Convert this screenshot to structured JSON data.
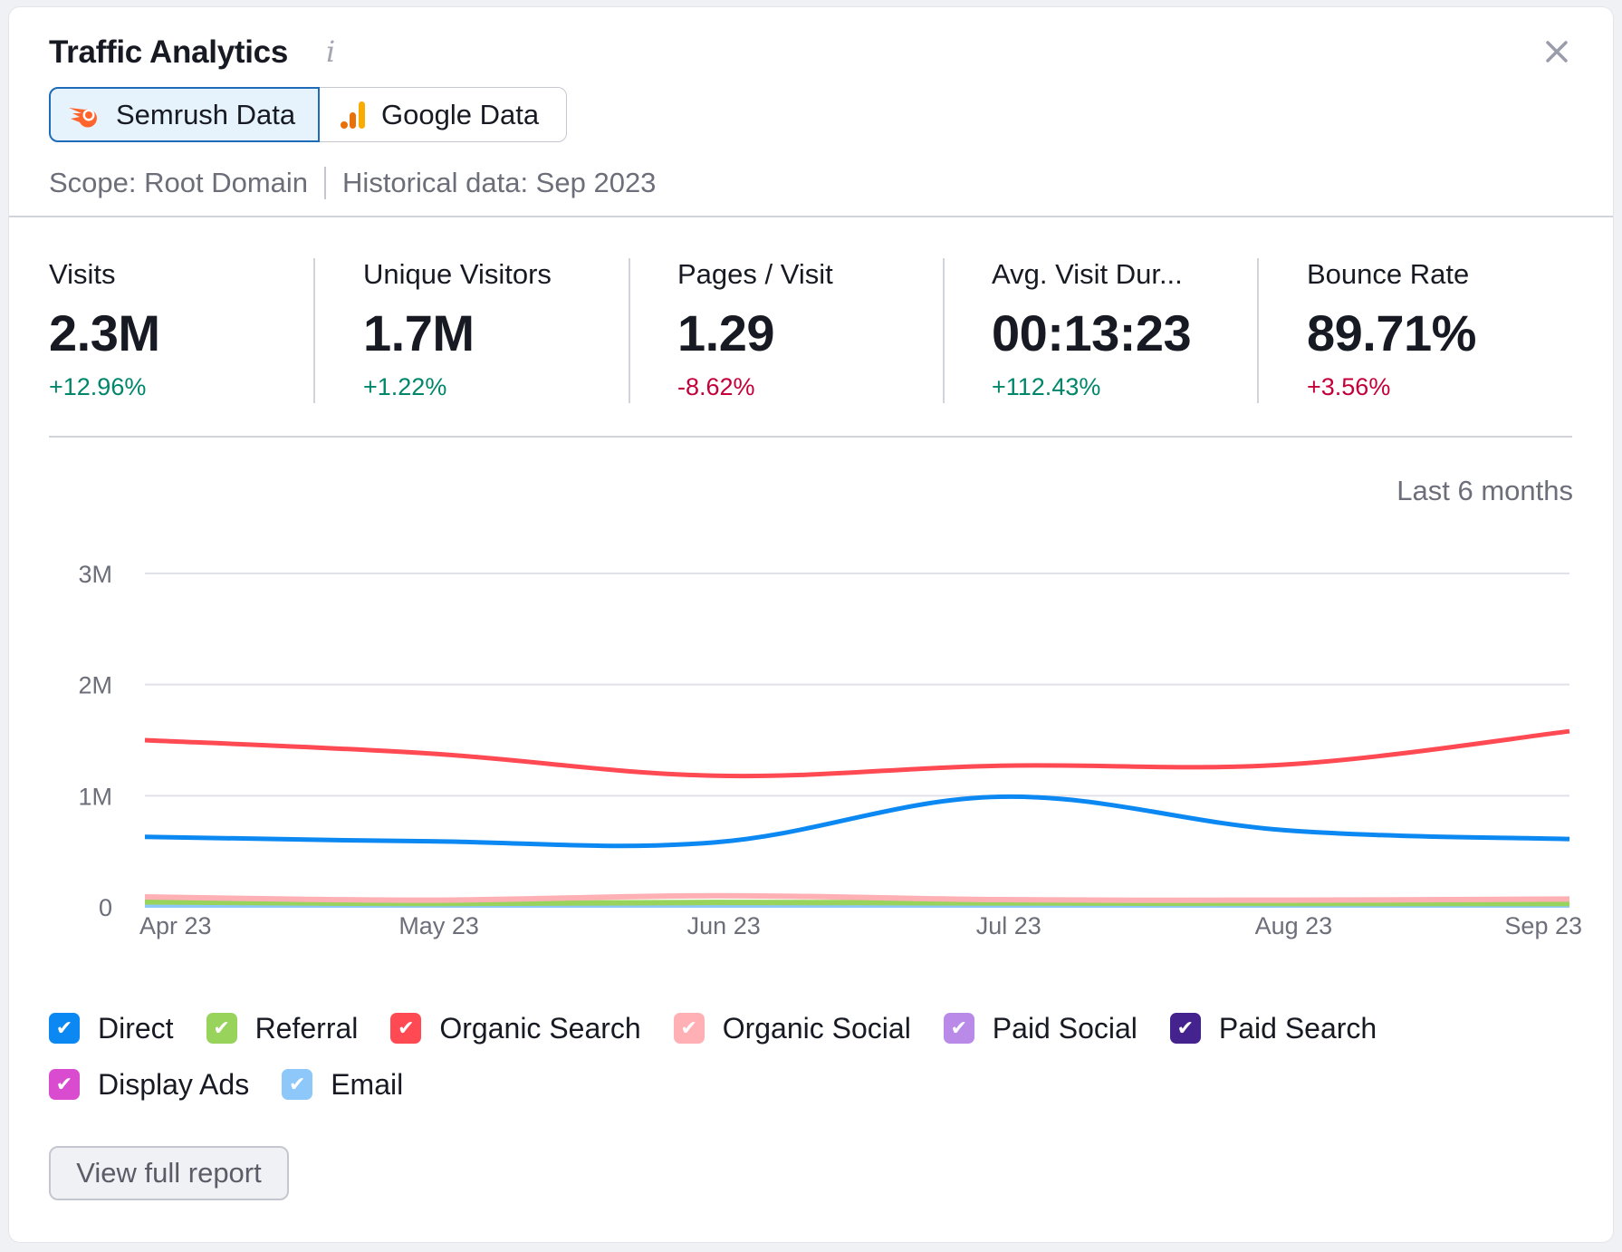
{
  "header": {
    "title": "Traffic Analytics",
    "info_icon": "info-icon",
    "close_icon": "close-icon"
  },
  "source_toggle": {
    "options": [
      {
        "label": "Semrush Data",
        "icon": "semrush-logo-icon",
        "active": true
      },
      {
        "label": "Google Data",
        "icon": "google-analytics-icon",
        "active": false
      }
    ]
  },
  "scope": {
    "scope_text": "Scope: Root Domain",
    "historical_text": "Historical data: Sep 2023"
  },
  "metrics": [
    {
      "label": "Visits",
      "value": "2.3M",
      "delta": "+12.96%",
      "trend": "up"
    },
    {
      "label": "Unique Visitors",
      "value": "1.7M",
      "delta": "+1.22%",
      "trend": "up"
    },
    {
      "label": "Pages / Visit",
      "value": "1.29",
      "delta": "-8.62%",
      "trend": "down"
    },
    {
      "label": "Avg. Visit Dur...",
      "value": "00:13:23",
      "delta": "+112.43%",
      "trend": "up"
    },
    {
      "label": "Bounce Rate",
      "value": "89.71%",
      "delta": "+3.56%",
      "trend": "down"
    }
  ],
  "colors": {
    "positive": "#00866b",
    "negative": "#c4003a",
    "accent": "#1e6bb8"
  },
  "period_label": "Last 6 months",
  "chart_data": {
    "type": "line",
    "title": "",
    "xlabel": "",
    "ylabel": "",
    "categories": [
      "Apr 23",
      "May 23",
      "Jun 23",
      "Jul 23",
      "Aug 23",
      "Sep 23"
    ],
    "ylim": [
      0,
      3000000
    ],
    "yticks": [
      0,
      1000000,
      2000000,
      3000000
    ],
    "ytick_labels": [
      "0",
      "1M",
      "2M",
      "3M"
    ],
    "grid": true,
    "legend_position": "bottom",
    "series": [
      {
        "name": "Direct",
        "color": "#0c88f2",
        "values": [
          630000,
          590000,
          580000,
          990000,
          690000,
          610000
        ]
      },
      {
        "name": "Referral",
        "color": "#98d35c",
        "values": [
          45000,
          30000,
          40000,
          35000,
          30000,
          30000
        ]
      },
      {
        "name": "Organic Search",
        "color": "#ff4953",
        "values": [
          1500000,
          1380000,
          1180000,
          1270000,
          1280000,
          1580000
        ]
      },
      {
        "name": "Organic Social",
        "color": "#ffb0b5",
        "values": [
          90000,
          60000,
          100000,
          65000,
          60000,
          70000
        ]
      },
      {
        "name": "Paid Social",
        "color": "#b98ae8",
        "values": [
          2000,
          2000,
          2000,
          2000,
          2000,
          2000
        ]
      },
      {
        "name": "Paid Search",
        "color": "#44238e",
        "values": [
          1000,
          1000,
          1000,
          1000,
          1000,
          1000
        ]
      },
      {
        "name": "Display Ads",
        "color": "#d94ccf",
        "values": [
          1000,
          1000,
          1000,
          1000,
          1000,
          1000
        ]
      },
      {
        "name": "Email",
        "color": "#8ec8fa",
        "values": [
          15000,
          15000,
          15000,
          15000,
          15000,
          15000
        ]
      }
    ]
  },
  "legend": {
    "rows": [
      [
        "Direct",
        "Referral",
        "Organic Search",
        "Organic Social",
        "Paid Social",
        "Paid Search"
      ],
      [
        "Display Ads",
        "Email"
      ]
    ],
    "checked": true
  },
  "footer": {
    "report_button": "View full report"
  }
}
